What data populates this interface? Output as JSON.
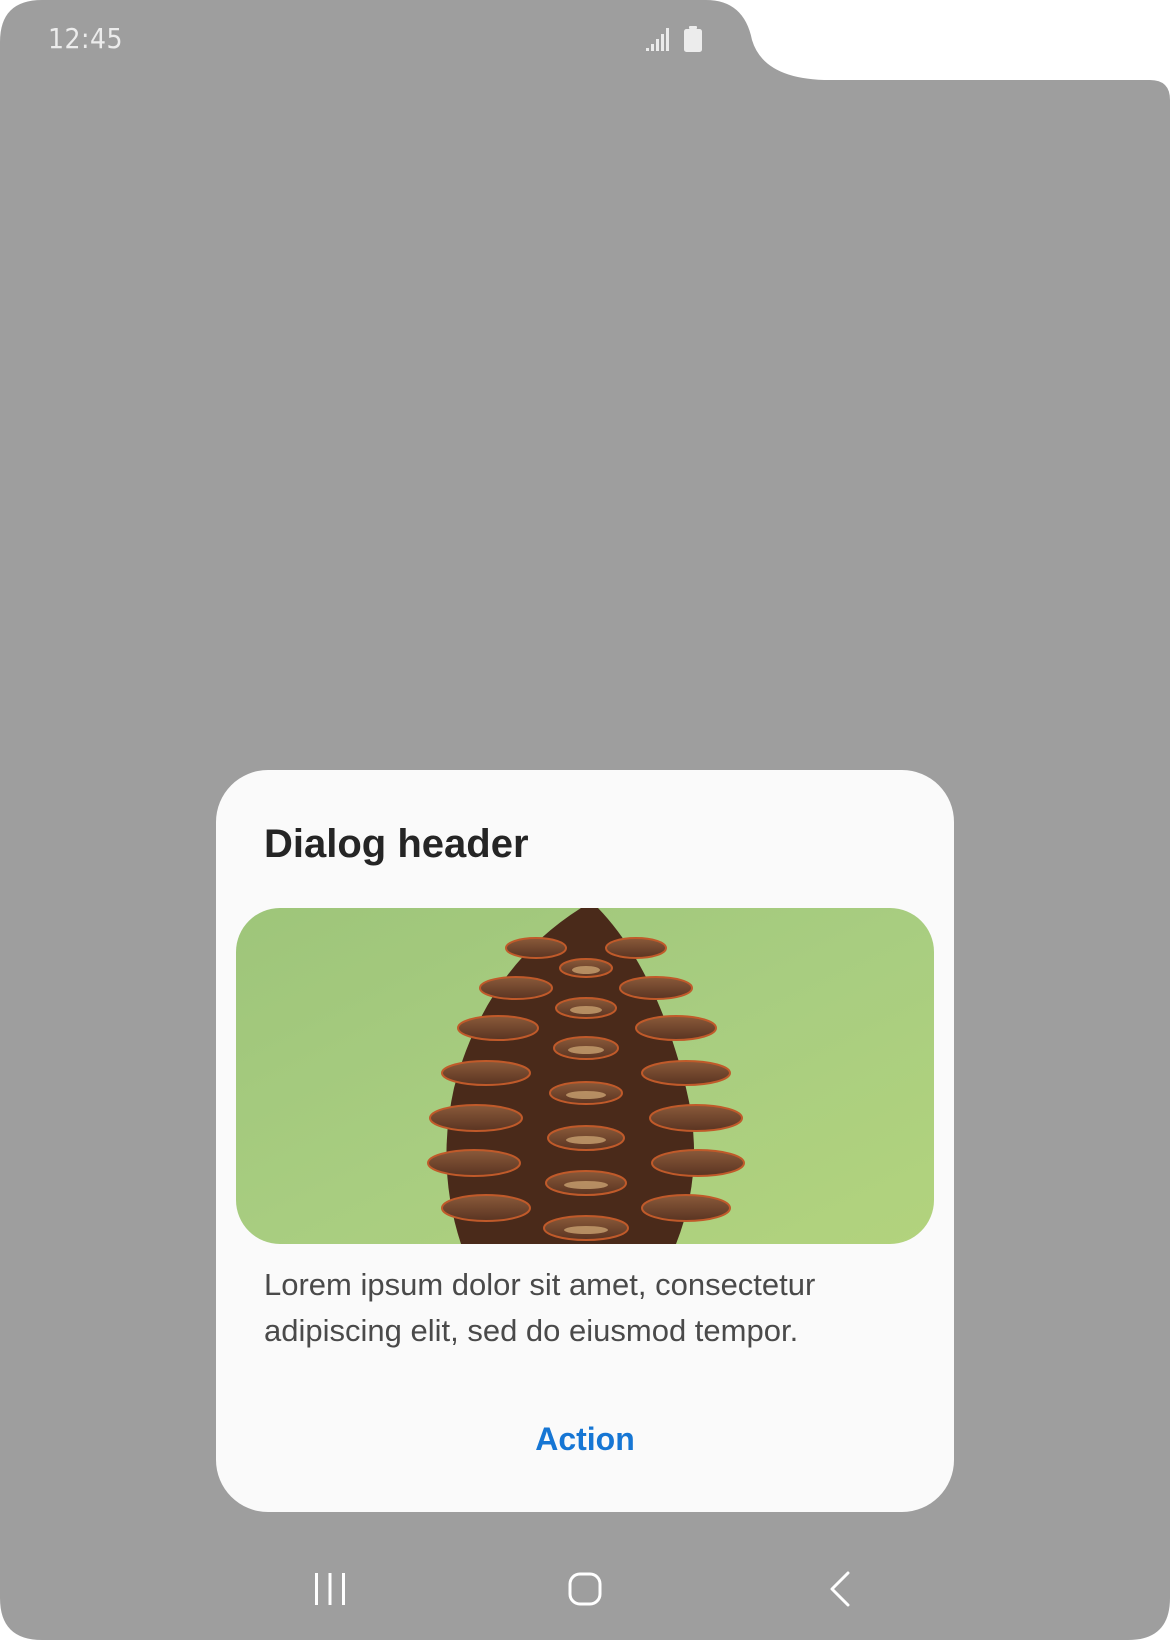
{
  "status_bar": {
    "time": "12:45",
    "icons": [
      "signal-icon",
      "battery-icon"
    ]
  },
  "dialog": {
    "header": "Dialog header",
    "image": "pine-cone-image",
    "body": "Lorem ipsum dolor sit amet, consectetur adipiscing elit, sed do eiusmod tempor.",
    "action_label": "Action"
  },
  "nav_bar": {
    "buttons": [
      "recents-icon",
      "home-icon",
      "back-icon"
    ]
  },
  "colors": {
    "scrim": "#9e9e9e",
    "dialog_bg": "#fafafa",
    "accent": "#1676d4",
    "header_text": "#252525",
    "body_text": "#4a4a4a"
  }
}
